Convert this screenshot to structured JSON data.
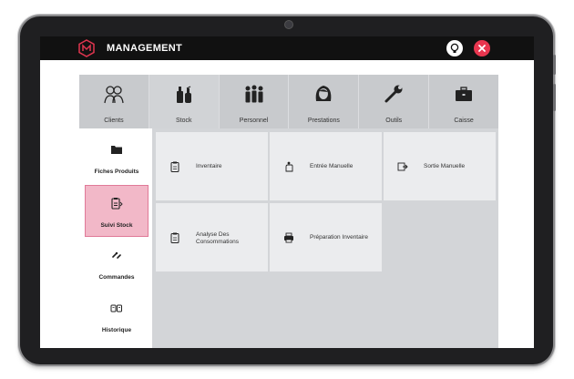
{
  "header": {
    "title": "MANAGEMENT"
  },
  "tabs": [
    {
      "label": "Clients"
    },
    {
      "label": "Stock"
    },
    {
      "label": "Personnel"
    },
    {
      "label": "Prestations"
    },
    {
      "label": "Outils"
    },
    {
      "label": "Caisse"
    }
  ],
  "sidebar": {
    "items": [
      {
        "label": "Fiches Produits"
      },
      {
        "label": "Suivi Stock"
      },
      {
        "label": "Commandes"
      },
      {
        "label": "Historique"
      }
    ]
  },
  "cards": [
    {
      "label": "Inventaire"
    },
    {
      "label": "Entrée Manuelle"
    },
    {
      "label": "Sortie Manuelle"
    },
    {
      "label_line1": "Analyse Des",
      "label_line2": "Consommations"
    },
    {
      "label": "Préparation Inventaire"
    }
  ],
  "colors": {
    "accent_pink": "#f2b8c8",
    "close_red": "#e8364f",
    "topbar": "#111111"
  }
}
